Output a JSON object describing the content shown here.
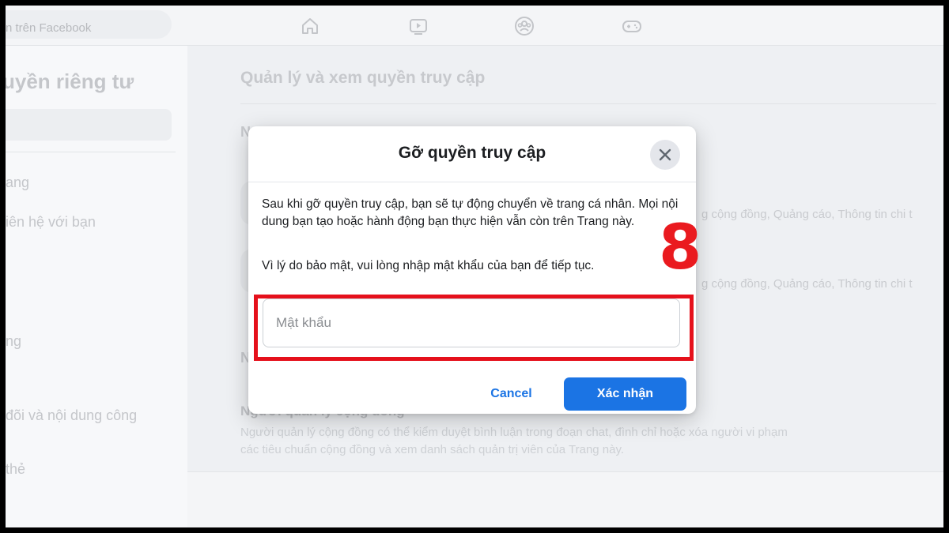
{
  "topbar": {
    "search_placeholder": "n trên Facebook",
    "nav_icons": [
      "home-icon",
      "video-icon",
      "groups-icon",
      "gaming-icon"
    ]
  },
  "sidebar": {
    "title": "uyền riêng tư",
    "items": [
      {
        "label": "ang"
      },
      {
        "label": "iên hệ với bạn"
      },
      {
        "label": "ng"
      },
      {
        "label": "đõi và nội dung công"
      },
      {
        "label": "thẻ"
      }
    ]
  },
  "main": {
    "title": "Quản lý và xem quyền truy cập",
    "heading_faint_1": "N",
    "heading_faint_2": "N",
    "row_faint_text_1": "g cộng đồng, Quảng cáo, Thông tin chi t",
    "row_faint_text_2": "g cộng đồng, Quảng cáo, Thông tin chi t",
    "section_title": "Người quản lý cộng đồng",
    "section_desc": "Người quản lý cộng đồng có thể kiểm duyệt bình luận trong đoạn chat, đình chỉ hoặc xóa người vi phạm các tiêu chuẩn cộng đồng và xem danh sách quản trị viên của Trang này."
  },
  "modal": {
    "title": "Gỡ quyền truy cập",
    "close_icon": "close-icon",
    "body_paragraph_1": "Sau khi gỡ quyền truy cập, bạn sẽ tự động chuyển về trang cá nhân. Mọi nội dung bạn tạo hoặc hành động bạn thực hiện vẫn còn trên Trang này.",
    "body_paragraph_2": "Vì lý do bảo mật, vui lòng nhập mật khẩu của bạn để tiếp tục.",
    "password_placeholder": "Mật khẩu",
    "password_value": "",
    "cancel_label": "Cancel",
    "confirm_label": "Xác nhận"
  },
  "annotation": {
    "step_number": "8",
    "highlight_color": "#e5101b"
  },
  "colors": {
    "accent": "#1b74e4",
    "annotation_red": "#ea1a1f"
  }
}
